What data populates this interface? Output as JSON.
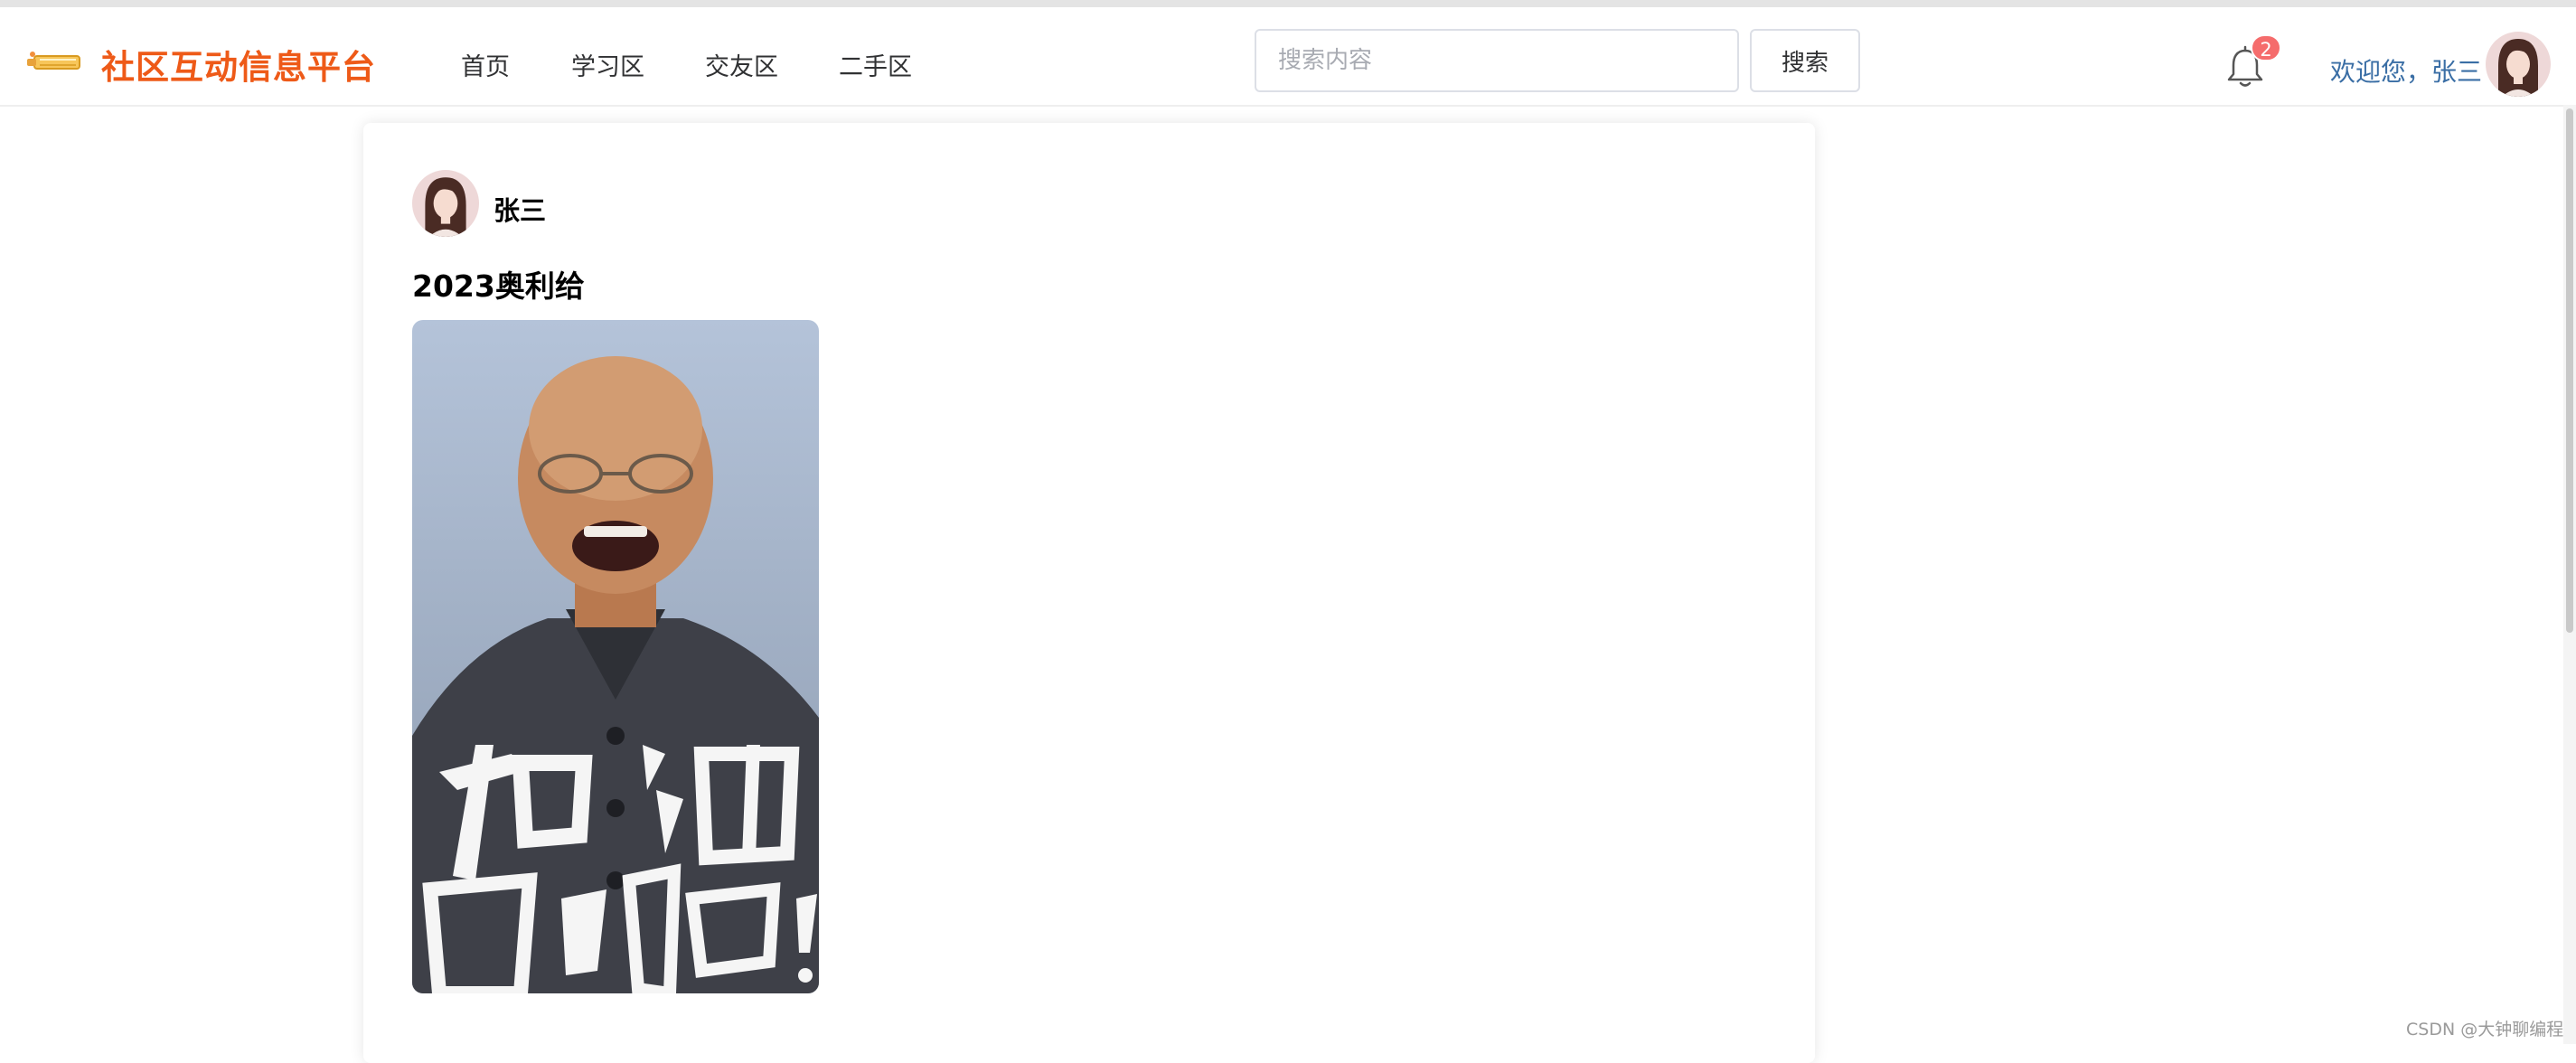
{
  "header": {
    "site_title": "社区互动信息平台",
    "logo_icon": "paintbrush-logo-icon",
    "nav": [
      "首页",
      "学习区",
      "交友区",
      "二手区"
    ],
    "search": {
      "placeholder": "搜索内容",
      "button_label": "搜索"
    },
    "notifications": {
      "icon": "bell-icon",
      "count": "2"
    },
    "welcome_text": "欢迎您，张三"
  },
  "post": {
    "author": "张三",
    "title": "2023奥利给",
    "image_caption": "加油奥利给！"
  },
  "watermark": "CSDN @大钟聊编程",
  "colors": {
    "brand": "#ee5a18",
    "badge": "#f56c6c",
    "welcome": "#3a6ea5"
  }
}
